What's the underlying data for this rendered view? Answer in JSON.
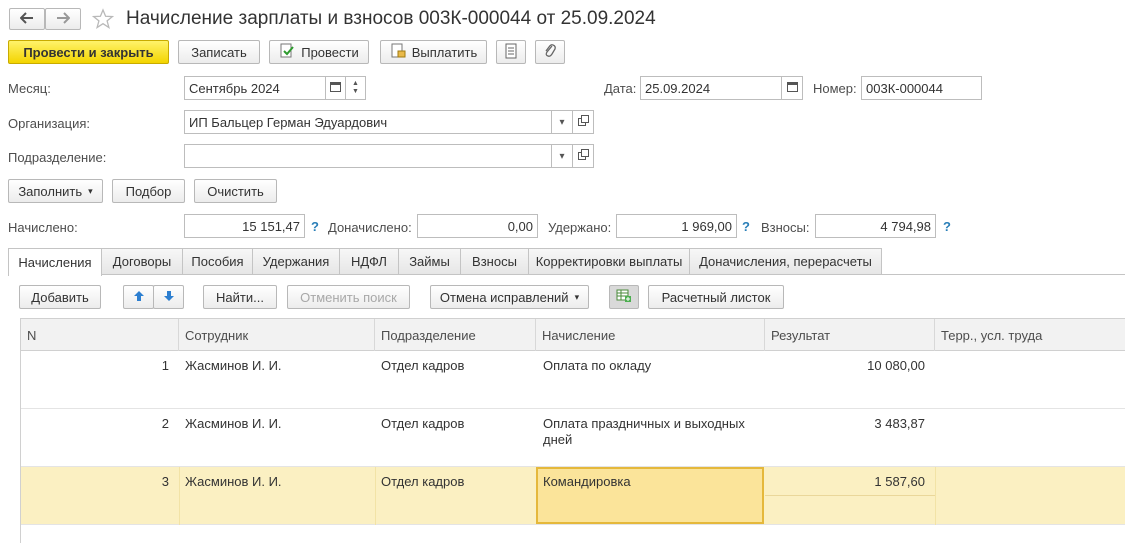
{
  "window": {
    "title": "Начисление зарплаты и взносов 003К-000044 от 25.09.2024",
    "back_icon": "arrow-left-icon",
    "forward_icon": "arrow-right-icon",
    "favorite_icon": "star-icon"
  },
  "toolbar": {
    "post_close_label": "Провести и закрыть",
    "save_label": "Записать",
    "post_label": "Провести",
    "pay_label": "Выплатить",
    "report_icon": "document-list-icon",
    "attach_icon": "paperclip-icon"
  },
  "form": {
    "month_label": "Месяц:",
    "month_value": "Сентябрь 2024",
    "date_label": "Дата:",
    "date_value": "25.09.2024",
    "number_label": "Номер:",
    "number_value": "003К-000044",
    "org_label": "Организация:",
    "org_value": "ИП Бальцер Герман Эдуардович",
    "dept_label": "Подразделение:",
    "dept_value": ""
  },
  "actions": {
    "fill_label": "Заполнить",
    "pick_label": "Подбор",
    "clear_label": "Очистить"
  },
  "totals": {
    "accrued_label": "Начислено:",
    "accrued_value": "15 151,47",
    "extra_label": "Доначислено:",
    "extra_value": "0,00",
    "withheld_label": "Удержано:",
    "withheld_value": "1 969,00",
    "contrib_label": "Взносы:",
    "contrib_value": "4 794,98",
    "help_mark": "?"
  },
  "tabs": [
    {
      "label": "Начисления",
      "active": true
    },
    {
      "label": "Договоры"
    },
    {
      "label": "Пособия"
    },
    {
      "label": "Удержания"
    },
    {
      "label": "НДФЛ"
    },
    {
      "label": "Займы"
    },
    {
      "label": "Взносы"
    },
    {
      "label": "Корректировки выплаты"
    },
    {
      "label": "Доначисления, перерасчеты"
    }
  ],
  "tab_toolbar": {
    "add_label": "Добавить",
    "up_icon": "arrow-up-icon",
    "down_icon": "arrow-down-icon",
    "find_label": "Найти...",
    "cancel_search_label": "Отменить поиск",
    "cancel_corrections_label": "Отмена исправлений",
    "grid_icon": "table-add-icon",
    "payslip_label": "Расчетный листок"
  },
  "table": {
    "columns": [
      "N",
      "Сотрудник",
      "Подразделение",
      "Начисление",
      "Результат",
      "Терр., усл. труда"
    ],
    "rows": [
      {
        "n": "1",
        "employee": "Жасминов И. И.",
        "dept": "Отдел кадров",
        "accrual": "Оплата по окладу",
        "result": "10 080,00",
        "terr": ""
      },
      {
        "n": "2",
        "employee": "Жасминов И. И.",
        "dept": "Отдел кадров",
        "accrual": "Оплата праздничных и выходных дней",
        "result": "3 483,87",
        "terr": ""
      },
      {
        "n": "3",
        "employee": "Жасминов И. И.",
        "dept": "Отдел кадров",
        "accrual": "Командировка",
        "result": "1 587,60",
        "terr": "",
        "selected": true
      }
    ]
  }
}
